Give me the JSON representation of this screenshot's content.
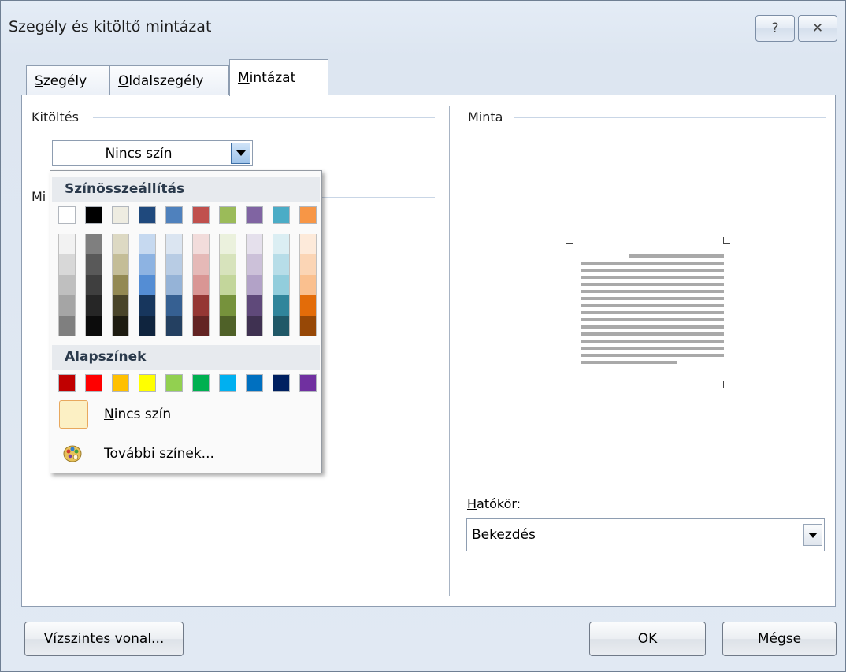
{
  "window": {
    "title": "Szegély és kitöltő mintázat",
    "help_icon": "question-icon",
    "close_icon": "close-icon"
  },
  "tabs": [
    {
      "label": "Szegély",
      "accel": "S",
      "rest": "zegély"
    },
    {
      "label": "Oldalszegély",
      "accel": "O",
      "rest": "ldalszegély"
    },
    {
      "label": "Mintázat",
      "accel": "M",
      "rest": "intázat",
      "active": true
    }
  ],
  "fill": {
    "group_label": "Kitöltés",
    "selected": "Nincs szín"
  },
  "pattern_group_label_partial": "Mi",
  "preview": {
    "group_label": "Minta"
  },
  "scope": {
    "label": "Hatókör:",
    "accel": "H",
    "rest": "atókör:",
    "value": "Bekezdés"
  },
  "buttons": {
    "horizontal_line": "Vízszintes vonal...",
    "hl_accel": "V",
    "hl_rest": "ízszintes vonal...",
    "ok": "OK",
    "cancel": "Mégse"
  },
  "color_popup": {
    "theme_header": "Színösszeállítás",
    "standard_header": "Alapszínek",
    "no_color": {
      "label": "Nincs szín",
      "accel": "N",
      "rest": "incs szín"
    },
    "more_colors": {
      "label": "További színek...",
      "accel": "T",
      "rest": "ovábbi színek...",
      "icon": "palette-icon"
    },
    "theme_top": [
      "#ffffff",
      "#000000",
      "#eeece1",
      "#1f497d",
      "#4f81bd",
      "#c0504d",
      "#9bbb59",
      "#8064a2",
      "#4bacc6",
      "#f79646"
    ],
    "theme_shades": [
      [
        "#f2f2f2",
        "#d8d8d8",
        "#bfbfbf",
        "#a5a5a5",
        "#7f7f7f"
      ],
      [
        "#7f7f7f",
        "#595959",
        "#3f3f3f",
        "#262626",
        "#0c0c0c"
      ],
      [
        "#ddd9c3",
        "#c4bd97",
        "#938953",
        "#494429",
        "#1d1b10"
      ],
      [
        "#c6d9f0",
        "#8db3e2",
        "#548dd4",
        "#17365d",
        "#0f243e"
      ],
      [
        "#dbe5f1",
        "#b8cce4",
        "#95b3d7",
        "#366092",
        "#244061"
      ],
      [
        "#f2dcdb",
        "#e5b9b7",
        "#d99694",
        "#953734",
        "#632423"
      ],
      [
        "#ebf1dd",
        "#d7e3bc",
        "#c3d69b",
        "#76923c",
        "#4f6128"
      ],
      [
        "#e5e0ec",
        "#ccc1d9",
        "#b2a2c7",
        "#5f497a",
        "#3f3151"
      ],
      [
        "#dbeef3",
        "#b7dde8",
        "#92cddc",
        "#31859b",
        "#205867"
      ],
      [
        "#fdeada",
        "#fbd5b5",
        "#fac08f",
        "#e36c09",
        "#974806"
      ]
    ],
    "standard": [
      "#c00000",
      "#ff0000",
      "#ffc000",
      "#ffff00",
      "#92d050",
      "#00b050",
      "#00b0f0",
      "#0070c0",
      "#002060",
      "#7030a0"
    ]
  }
}
